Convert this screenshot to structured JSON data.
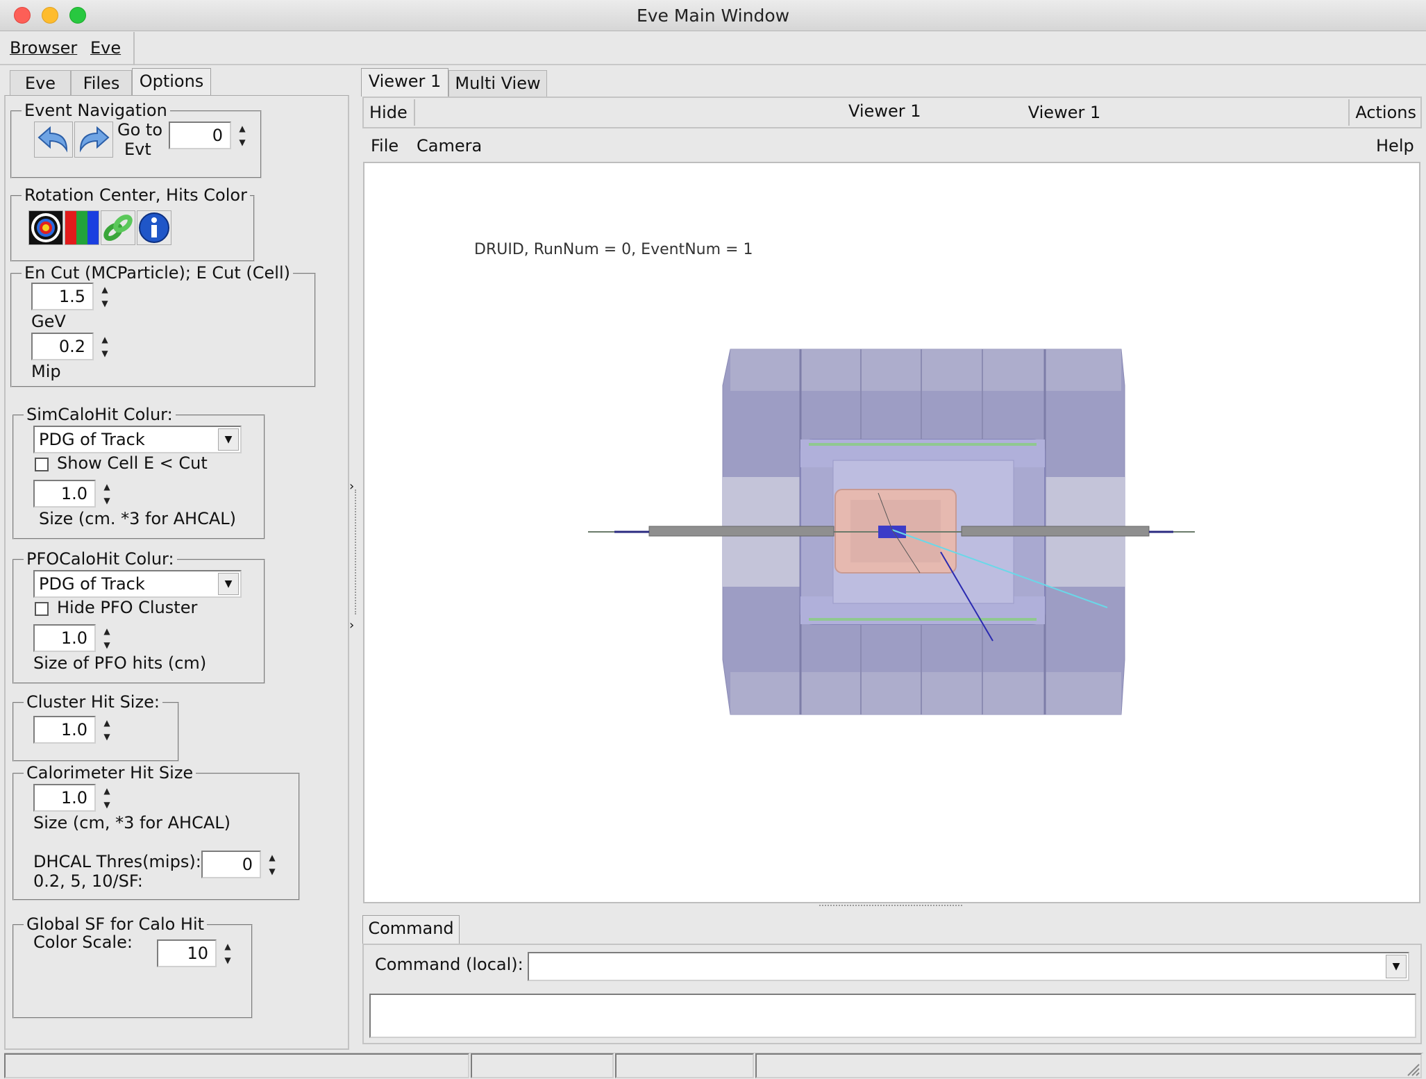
{
  "window": {
    "title": "Eve Main Window"
  },
  "menubar": {
    "items": [
      "Browser",
      "Eve"
    ]
  },
  "left_tabs": [
    "Eve",
    "Files",
    "Options"
  ],
  "event_navigation": {
    "title": "Event Navigation",
    "goto_label_1": "Go to",
    "goto_label_2": "Evt",
    "event_value": "0"
  },
  "rotation": {
    "title": "Rotation Center, Hits Color"
  },
  "en_cut": {
    "title": "En Cut (MCParticle); E Cut (Cell)",
    "value1": "1.5",
    "unit1": "GeV",
    "value2": "0.2",
    "unit2": "Mip"
  },
  "simcalohit": {
    "title": "SimCaloHit Colur:",
    "combo_value": "PDG of Track",
    "checkbox_label": "Show Cell E < Cut",
    "size_value": "1.0",
    "size_label": "Size (cm. *3 for AHCAL)"
  },
  "pfocalohit": {
    "title": "PFOCaloHit Colur:",
    "combo_value": "PDG of Track",
    "checkbox_label": "Hide PFO Cluster",
    "size_value": "1.0",
    "size_label": "Size of PFO hits (cm)"
  },
  "cluster_hit": {
    "title": "Cluster Hit Size:",
    "value": "1.0"
  },
  "calorimeter_hit": {
    "title": "Calorimeter Hit Size",
    "value": "1.0",
    "size_label": "Size (cm, *3 for AHCAL)",
    "dhcal_label_1": "DHCAL Thres(mips):",
    "dhcal_label_2": "0.2, 5, 10/SF:",
    "dhcal_value": "0"
  },
  "global_sf": {
    "title": "Global SF for Calo Hit",
    "label": "Color Scale:",
    "value": "10"
  },
  "right_tabs": [
    "Viewer 1",
    "Multi View"
  ],
  "viewer_header": {
    "hide": "Hide",
    "title": "Viewer 1",
    "actions": "Actions"
  },
  "viewer_menu": {
    "file": "File",
    "camera": "Camera",
    "help": "Help"
  },
  "viewer": {
    "event_label": "DRUID, RunNum = 0, EventNum = 1"
  },
  "command": {
    "tab": "Command",
    "label": "Command (local):",
    "value": ""
  },
  "colors": {
    "close": "#fd5f57",
    "minimize": "#febc2e",
    "zoom": "#28c840",
    "detector_outer": "#9a9ac0",
    "detector_inner": "#e6b9b0"
  }
}
